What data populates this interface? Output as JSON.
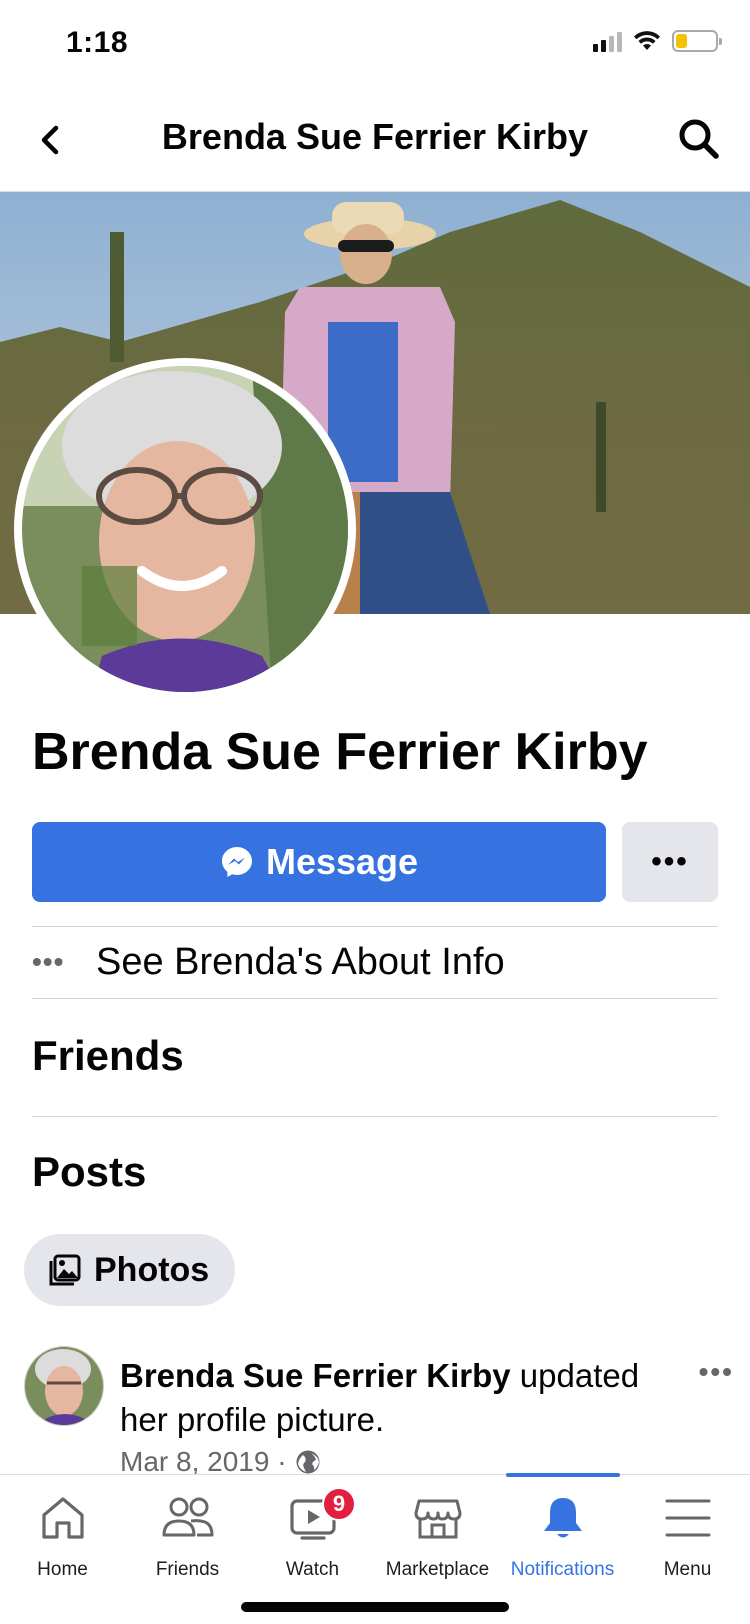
{
  "status_bar": {
    "time": "1:18"
  },
  "header": {
    "title": "Brenda Sue Ferrier Kirby"
  },
  "profile": {
    "name": "Brenda Sue Ferrier Kirby",
    "message_label": "Message",
    "more_label": "•••",
    "about_dots": "•••",
    "about_label": "See Brenda's About Info"
  },
  "sections": {
    "friends": "Friends",
    "posts": "Posts"
  },
  "photos_chip": {
    "label": "Photos"
  },
  "post": {
    "author": "Brenda Sue Ferrier Kirby",
    "action": " updated her profile picture.",
    "date": "Mar 8, 2019 ·",
    "more": "•••"
  },
  "bottom_nav": {
    "items": [
      {
        "label": "Home",
        "icon": "home-icon"
      },
      {
        "label": "Friends",
        "icon": "friends-icon"
      },
      {
        "label": "Watch",
        "icon": "watch-icon",
        "badge": "9"
      },
      {
        "label": "Marketplace",
        "icon": "marketplace-icon"
      },
      {
        "label": "Notifications",
        "icon": "bell-icon",
        "active": true
      },
      {
        "label": "Menu",
        "icon": "menu-icon"
      }
    ]
  },
  "colors": {
    "accent": "#3672e0",
    "badge": "#e41e3f",
    "chip_bg": "#e4e6eb"
  }
}
